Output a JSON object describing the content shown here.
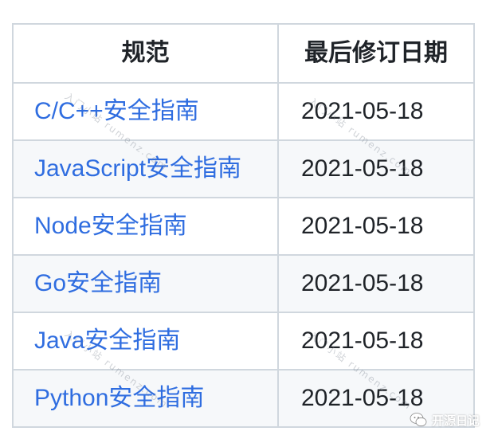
{
  "table": {
    "headers": [
      "规范",
      "最后修订日期"
    ],
    "rows": [
      {
        "name": "C/C++安全指南",
        "date": "2021-05-18"
      },
      {
        "name": "JavaScript安全指南",
        "date": "2021-05-18"
      },
      {
        "name": "Node安全指南",
        "date": "2021-05-18"
      },
      {
        "name": "Go安全指南",
        "date": "2021-05-18"
      },
      {
        "name": "Java安全指南",
        "date": "2021-05-18"
      },
      {
        "name": "Python安全指南",
        "date": "2021-05-18"
      }
    ]
  },
  "watermark": "入门小站 rumenz.com",
  "brand": {
    "label": "开源日记",
    "icon": "wechat-bubble-icon"
  },
  "colors": {
    "link": "#2f6de0",
    "border": "#d0d7de",
    "stripe": "#f6f8fa",
    "text": "#1f2328"
  }
}
